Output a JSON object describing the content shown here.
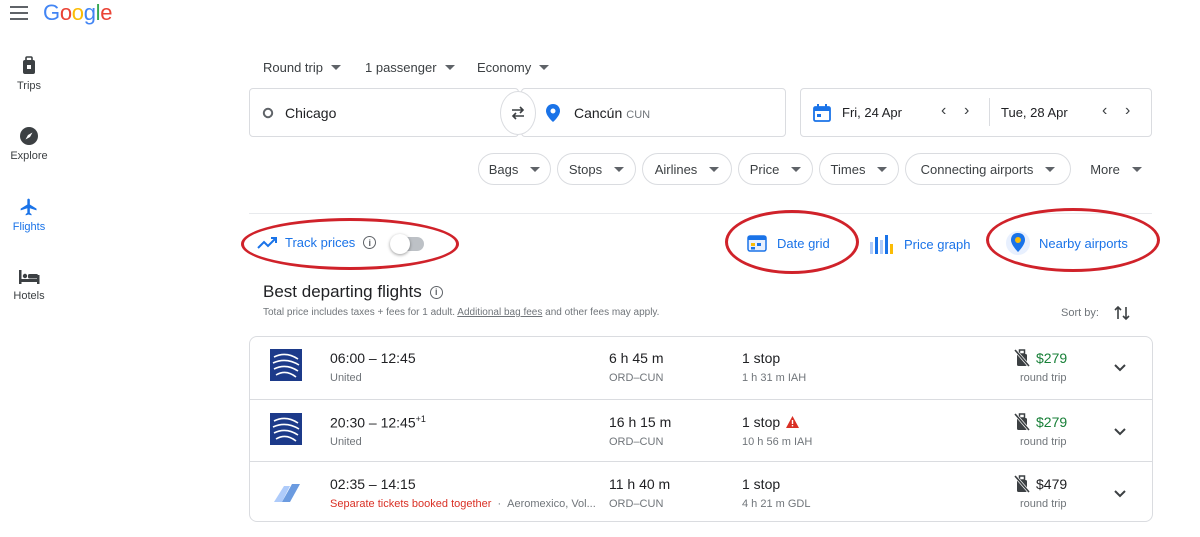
{
  "header": {
    "logo": [
      "G",
      "o",
      "o",
      "g",
      "l",
      "e"
    ]
  },
  "nav": {
    "items": [
      {
        "label": "Trips",
        "icon": "trips-icon"
      },
      {
        "label": "Explore",
        "icon": "explore-icon"
      },
      {
        "label": "Flights",
        "icon": "flights-icon",
        "active": true
      },
      {
        "label": "Hotels",
        "icon": "hotels-icon"
      }
    ]
  },
  "search": {
    "trip_type": "Round trip",
    "passengers": "1 passenger",
    "cabin": "Economy",
    "origin": "Chicago",
    "destination": "Cancún",
    "destination_code": "CUN",
    "depart_date": "Fri, 24 Apr",
    "return_date": "Tue, 28 Apr"
  },
  "filters": [
    "Bags",
    "Stops",
    "Airlines",
    "Price",
    "Times",
    "Connecting airports",
    "More"
  ],
  "tools": {
    "track_prices": "Track prices",
    "date_grid": "Date grid",
    "price_graph": "Price graph",
    "nearby_airports": "Nearby airports"
  },
  "results": {
    "heading": "Best departing flights",
    "subtext_prefix": "Total price includes taxes + fees for 1 adult. ",
    "subtext_link": "Additional bag fees",
    "subtext_suffix": " and other fees may apply.",
    "sort_label": "Sort by:",
    "flights": [
      {
        "times": "06:00 – 12:45",
        "times_suffix": "",
        "airline": "United",
        "airline_note": "",
        "duration": "6 h 45 m",
        "route": "ORD–CUN",
        "stops": "1 stop",
        "layover": "1 h 31 m IAH",
        "price": "$279",
        "price_label": "round trip"
      },
      {
        "times": "20:30 – 12:45",
        "times_suffix": "+1",
        "airline": "United",
        "airline_note": "",
        "duration": "16 h 15 m",
        "route": "ORD–CUN",
        "stops": "1 stop",
        "layover": "10 h 56 m IAH",
        "price": "$279",
        "price_label": "round trip"
      },
      {
        "times": "02:35 – 14:15",
        "times_suffix": "",
        "airline": "Aeromexico, Vol...",
        "airline_note": "Separate tickets booked together",
        "duration": "11 h 40 m",
        "route": "ORD–CUN",
        "stops": "1 stop",
        "layover": "4 h 21 m GDL",
        "price": "$479",
        "price_label": "round trip"
      }
    ]
  },
  "colors": {
    "accent": "#1a73e8",
    "price_green": "#188038",
    "annotation_red": "#d0222a",
    "warning_red": "#d93025"
  }
}
